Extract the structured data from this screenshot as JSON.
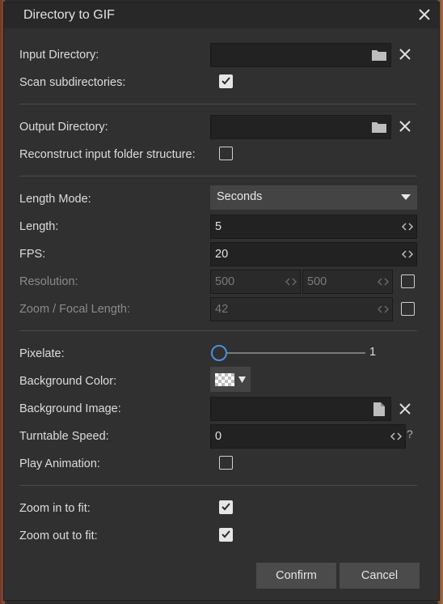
{
  "dialog": {
    "title": "Directory to GIF"
  },
  "input": {
    "dir_label": "Input Directory:",
    "dir_value": "",
    "scan_label": "Scan subdirectories:",
    "scan_checked": true
  },
  "output": {
    "dir_label": "Output Directory:",
    "dir_value": "",
    "reconstruct_label": "Reconstruct input folder structure:",
    "reconstruct_checked": false
  },
  "timing": {
    "length_mode_label": "Length Mode:",
    "length_mode_value": "Seconds",
    "length_label": "Length:",
    "length_value": "5",
    "fps_label": "FPS:",
    "fps_value": "20",
    "resolution_label": "Resolution:",
    "resolution_w": "500",
    "resolution_h": "500",
    "resolution_enabled": false,
    "zoom_label": "Zoom / Focal Length:",
    "zoom_value": "42",
    "zoom_enabled": false
  },
  "appearance": {
    "pixelate_label": "Pixelate:",
    "pixelate_value": "1",
    "bg_color_label": "Background Color:",
    "bg_image_label": "Background Image:",
    "bg_image_value": "",
    "turntable_label": "Turntable Speed:",
    "turntable_value": "0",
    "turntable_help": "?",
    "play_anim_label": "Play Animation:",
    "play_anim_checked": false
  },
  "fit": {
    "zoom_in_label": "Zoom in to fit:",
    "zoom_in_checked": true,
    "zoom_out_label": "Zoom out to fit:",
    "zoom_out_checked": true
  },
  "buttons": {
    "confirm": "Confirm",
    "cancel": "Cancel"
  },
  "colors": {
    "accent": "#4a8fe0",
    "panel": "#303030",
    "field": "#222222"
  }
}
